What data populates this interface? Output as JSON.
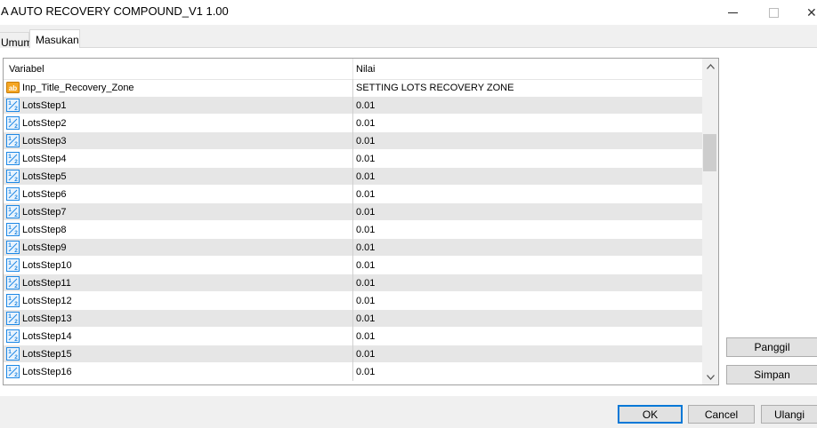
{
  "window": {
    "title": "A AUTO RECOVERY COMPOUND_V1 1.00",
    "close_glyph": "✕"
  },
  "tabs": [
    {
      "label": "Umum",
      "active": false
    },
    {
      "label": "Masukan",
      "active": true
    }
  ],
  "grid": {
    "columns": {
      "variable": "Variabel",
      "value": "Nilai"
    },
    "rows": [
      {
        "icon": "string-ab-icon",
        "name": "Inp_Title_Recovery_Zone",
        "value": "SETTING LOTS RECOVERY ZONE"
      },
      {
        "icon": "fraction-half-icon",
        "name": "LotsStep1",
        "value": "0.01"
      },
      {
        "icon": "fraction-half-icon",
        "name": "LotsStep2",
        "value": "0.01"
      },
      {
        "icon": "fraction-half-icon",
        "name": "LotsStep3",
        "value": "0.01"
      },
      {
        "icon": "fraction-half-icon",
        "name": "LotsStep4",
        "value": "0.01"
      },
      {
        "icon": "fraction-half-icon",
        "name": "LotsStep5",
        "value": "0.01"
      },
      {
        "icon": "fraction-half-icon",
        "name": "LotsStep6",
        "value": "0.01"
      },
      {
        "icon": "fraction-half-icon",
        "name": "LotsStep7",
        "value": "0.01"
      },
      {
        "icon": "fraction-half-icon",
        "name": "LotsStep8",
        "value": "0.01"
      },
      {
        "icon": "fraction-half-icon",
        "name": "LotsStep9",
        "value": "0.01"
      },
      {
        "icon": "fraction-half-icon",
        "name": "LotsStep10",
        "value": "0.01"
      },
      {
        "icon": "fraction-half-icon",
        "name": "LotsStep11",
        "value": "0.01"
      },
      {
        "icon": "fraction-half-icon",
        "name": "LotsStep12",
        "value": "0.01"
      },
      {
        "icon": "fraction-half-icon",
        "name": "LotsStep13",
        "value": "0.01"
      },
      {
        "icon": "fraction-half-icon",
        "name": "LotsStep14",
        "value": "0.01"
      },
      {
        "icon": "fraction-half-icon",
        "name": "LotsStep15",
        "value": "0.01"
      },
      {
        "icon": "fraction-half-icon",
        "name": "LotsStep16",
        "value": "0.01"
      }
    ]
  },
  "side_buttons": {
    "load": "Panggil",
    "save": "Simpan"
  },
  "footer_buttons": {
    "ok": "OK",
    "cancel": "Cancel",
    "reset": "Ulangi"
  },
  "colors": {
    "row_alt": "#e6e6e6",
    "accent": "#0078d7",
    "icon_blue": "#1e88e5",
    "icon_orange": "#f5a623"
  }
}
